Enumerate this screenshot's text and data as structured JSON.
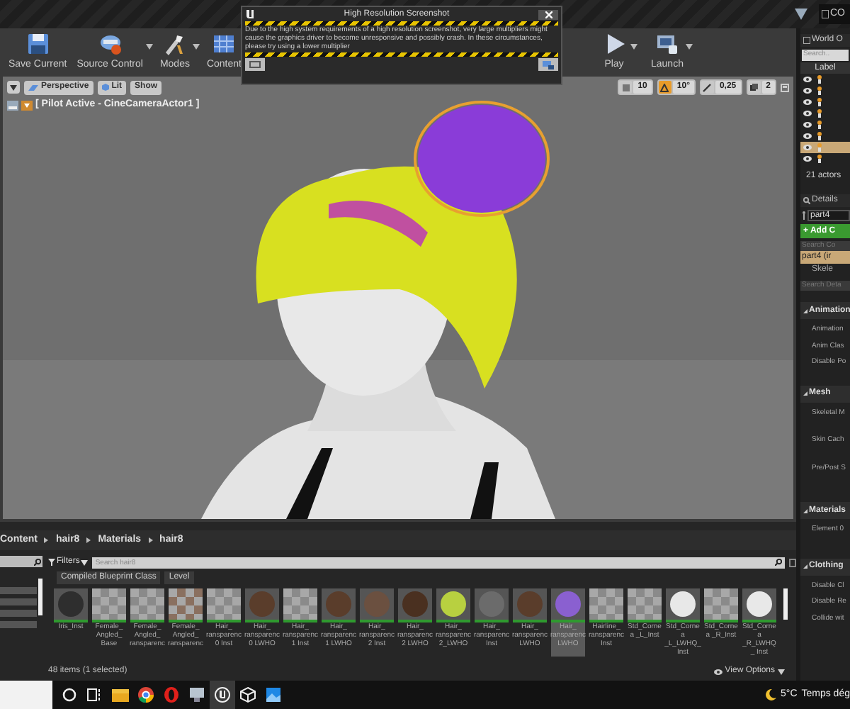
{
  "title_bar": {
    "tab_text": "CO"
  },
  "toolbar": {
    "left_buttons": [
      {
        "label": "Save Current",
        "kind": "save",
        "dropdown": false
      },
      {
        "label": "Source Control",
        "kind": "source",
        "dropdown": true
      },
      {
        "label": "Modes",
        "kind": "modes",
        "dropdown": true
      },
      {
        "label": "Content",
        "kind": "content",
        "dropdown": false
      }
    ],
    "right_buttons": [
      {
        "label": "Play",
        "kind": "play",
        "dropdown": true
      },
      {
        "label": "Launch",
        "kind": "launch",
        "dropdown": true
      }
    ]
  },
  "dialog": {
    "title": "High Resolution Screenshot",
    "message": "Due to the high system requirements of a high resolution screenshot, very large multipliers might cause the graphics driver to become unresponsive and possibly crash. In these circumstances, please try using a lower multiplier"
  },
  "viewport": {
    "view_mode": "Perspective",
    "lighting": "Lit",
    "show": "Show",
    "pilot_label": "[ Pilot Active - CineCameraActor1 ]",
    "snaps": [
      {
        "value": "10",
        "on": false
      },
      {
        "value": "10°",
        "on": true
      },
      {
        "value": "0,25",
        "on": false
      },
      {
        "value": "2",
        "on": false
      }
    ]
  },
  "outliner": {
    "title": "World O",
    "search": "Search..",
    "column": "Label",
    "count": "21 actors",
    "rows": [
      {
        "selected": false
      },
      {
        "selected": false
      },
      {
        "selected": false
      },
      {
        "selected": false
      },
      {
        "selected": false
      },
      {
        "selected": false
      },
      {
        "selected": true
      },
      {
        "selected": false
      }
    ]
  },
  "details": {
    "title": "Details",
    "name_value": "part4",
    "add_button": "+ Add C",
    "component_search": "Search Co",
    "components": [
      {
        "label": "part4 (ir",
        "selected": true
      },
      {
        "label": "Skele",
        "selected": false
      }
    ],
    "details_search": "Search Deta",
    "sections": [
      {
        "title": "Animation",
        "properties": [
          "Animation",
          "Anim Clas",
          "Disable Po"
        ]
      },
      {
        "title": "Mesh",
        "properties": [
          "Skeletal M",
          "Skin Cach",
          "Pre/Post S"
        ]
      },
      {
        "title": "Materials",
        "properties": [
          "Element 0"
        ]
      },
      {
        "title": "Clothing",
        "properties": [
          "Disable Cl",
          "Disable Re",
          "Collide wit"
        ]
      }
    ]
  },
  "content_browser": {
    "path": [
      "Content",
      "hair8",
      "Materials",
      "hair8"
    ],
    "filters": "Filters",
    "search_placeholder": "Search hair8",
    "chips": [
      "Compiled Blueprint Class",
      "Level"
    ],
    "assets": [
      {
        "label": "Iris_Inst",
        "kind": "sphere",
        "color": "#2e2e2e",
        "selected": false
      },
      {
        "label": "Female_ Angled_ Base",
        "kind": "checker",
        "color": "#8a8a8a",
        "selected": false
      },
      {
        "label": "Female_ Angled_ ransparenc",
        "kind": "checker",
        "color": "#8a8a8a",
        "selected": false
      },
      {
        "label": "Female_ Angled_ ransparenc",
        "kind": "checker",
        "color": "#8a7060",
        "selected": false
      },
      {
        "label": "Hair_ ransparenc 0 Inst",
        "kind": "checker",
        "color": "#8a8a8a",
        "selected": false
      },
      {
        "label": "Hair_ ransparenc 0 LWHO",
        "kind": "sphere",
        "color": "#5a3d2b",
        "selected": false
      },
      {
        "label": "Hair_ ransparenc 1 Inst",
        "kind": "checker",
        "color": "#8a8a8a",
        "selected": false
      },
      {
        "label": "Hair_ ransparenc 1 LWHO",
        "kind": "sphere",
        "color": "#5a3d2b",
        "selected": false
      },
      {
        "label": "Hair_ ransparenc 2 Inst",
        "kind": "sphere",
        "color": "#6b5040",
        "selected": false
      },
      {
        "label": "Hair_ ransparenc 2 LWHO",
        "kind": "sphere",
        "color": "#4a3020",
        "selected": false
      },
      {
        "label": "Hair_ ransparenc 2_LWHO",
        "kind": "sphere",
        "color": "#b8d040",
        "selected": false
      },
      {
        "label": "Hair_ ransparenc Inst",
        "kind": "sphere",
        "color": "#6b6b6b",
        "selected": false
      },
      {
        "label": "Hair_ ransparenc LWHO",
        "kind": "sphere",
        "color": "#5a3d2b",
        "selected": false
      },
      {
        "label": "Hair_ ransparenc LWHO",
        "kind": "sphere",
        "color": "#8a60d0",
        "selected": true
      },
      {
        "label": "Hairline_ ransparenc Inst",
        "kind": "checker",
        "color": "#8a8a8a",
        "selected": false
      },
      {
        "label": "Std_Cornea _L_Inst",
        "kind": "checker",
        "color": "#8a8a8a",
        "selected": false
      },
      {
        "label": "Std_Cornea _L_LWHQ_ Inst",
        "kind": "sphere",
        "color": "#e8e8e8",
        "selected": false
      },
      {
        "label": "Std_Cornea _R_Inst",
        "kind": "checker",
        "color": "#8a8a8a",
        "selected": false
      },
      {
        "label": "Std_Cornea _R_LWHQ_ Inst",
        "kind": "sphere",
        "color": "#e8e8e8",
        "selected": false
      }
    ],
    "status": "48 items (1 selected)",
    "view_options": "View Options"
  },
  "taskbar": {
    "apps": [
      {
        "kind": "cortana",
        "selected": false
      },
      {
        "kind": "taskview",
        "selected": false
      },
      {
        "kind": "folder",
        "selected": false
      },
      {
        "kind": "chrome",
        "selected": false
      },
      {
        "kind": "opera",
        "selected": false
      },
      {
        "kind": "monitor",
        "selected": false
      },
      {
        "kind": "unreal",
        "selected": true
      },
      {
        "kind": "cube",
        "selected": false
      },
      {
        "kind": "photos",
        "selected": false
      }
    ],
    "temperature": "5°C",
    "weather": "Temps dég"
  }
}
